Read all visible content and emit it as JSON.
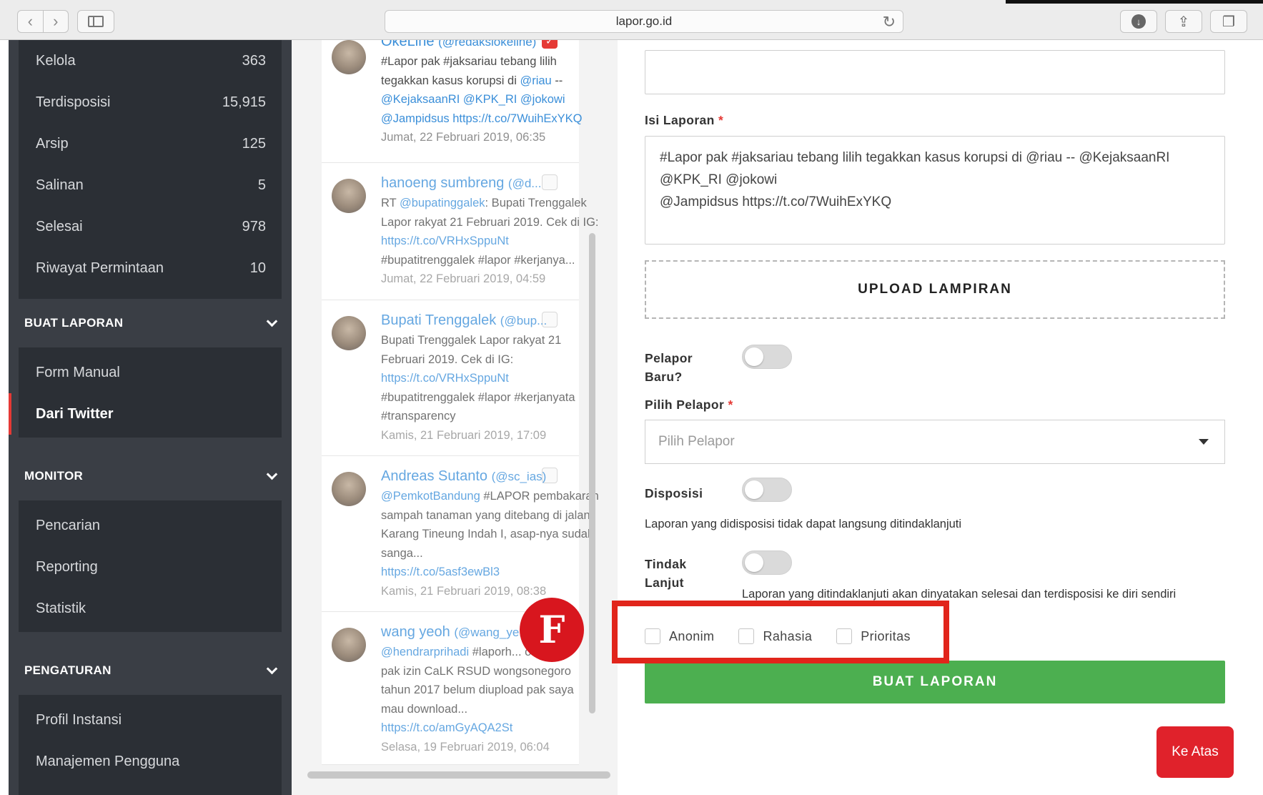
{
  "browser": {
    "url": "lapor.go.id",
    "back_icon": "chevron-left-icon",
    "forward_icon": "chevron-right-icon"
  },
  "sidebar": {
    "top_items": [
      {
        "label": "Kelola",
        "count": "363"
      },
      {
        "label": "Terdisposisi",
        "count": "15,915"
      },
      {
        "label": "Arsip",
        "count": "125"
      },
      {
        "label": "Salinan",
        "count": "5"
      },
      {
        "label": "Selesai",
        "count": "978"
      },
      {
        "label": "Riwayat Permintaan",
        "count": "10"
      }
    ],
    "sections": [
      {
        "title": "BUAT LAPORAN",
        "items": [
          "Form Manual",
          "Dari Twitter"
        ]
      },
      {
        "title": "MONITOR",
        "items": [
          "Pencarian",
          "Reporting",
          "Statistik"
        ]
      },
      {
        "title": "PENGATURAN",
        "items": [
          "Profil Instansi",
          "Manajemen Pengguna"
        ]
      }
    ],
    "active_item": "Dari Twitter",
    "accent_color": "#e53935"
  },
  "tweets": [
    {
      "name": "OkeLine",
      "handle": "(@redaksiokeline)",
      "text": "#Lapor pak #jaksariau tebang lilih tegakkan kasus korupsi di",
      "mention1": "@riau",
      "text2": "--",
      "line3": "@KejaksaanRI @KPK_RI @jokowi",
      "line4": "@Jampidsus https://t.co/7WuihExYKQ",
      "time": "Jumat, 22 Februari 2019, 06:35",
      "checked": true
    },
    {
      "name": "hanoeng sumbreng",
      "handle": "(@d...",
      "prefix": "RT",
      "mention": "@bupatinggalek",
      "text": ": Bupati Trenggalek Lapor rakyat 21 Februari 2019. Cek di IG:",
      "link": "https://t.co/VRHxSppuNt",
      "tags": "#bupatitrenggalek #lapor #kerjanya...",
      "time": "Jumat, 22 Februari 2019, 04:59"
    },
    {
      "name": "Bupati Trenggalek",
      "handle": "(@bup...",
      "text": "Bupati Trenggalek Lapor rakyat 21 Februari 2019. Cek di IG:",
      "link": "https://t.co/VRHxSppuNt",
      "tags": "#bupatitrenggalek #lapor #kerjanyata #transparency",
      "time": "Kamis, 21 Februari 2019, 17:09"
    },
    {
      "name": "Andreas Sutanto",
      "handle": "(@sc_ias)",
      "mention": "@PemkotBandung",
      "text": "#LAPOR pembakaran sampah tanaman yang ditebang di jalan Karang Tineung Indah I, asap-nya sudah sanga...",
      "link": "https://t.co/5asf3ewBl3",
      "time": "Kamis, 21 Februari 2019, 08:38"
    },
    {
      "name": "wang yeoh",
      "handle": "(@wang_ye...",
      "mention": "@hendrarprihadi",
      "text": "#laporh...",
      "text_tail": "or",
      "text2": "pak izin CaLK RSUD wongsonegoro tahun 2017 belum diupload pak saya mau download...",
      "link": "https://t.co/amGyAQA2St",
      "time": "Selasa, 19 Februari 2019, 06:04"
    }
  ],
  "form": {
    "isi_label": "Isi Laporan",
    "required_mark": "*",
    "isi_value_line1": "#Lapor pak #jaksariau tebang lilih tegakkan kasus korupsi di @riau -- @KejaksaanRI",
    "isi_value_line2": "@KPK_RI @jokowi",
    "isi_value_line3": "@Jampidsus https://t.co/7WuihExYKQ",
    "upload_label": "UPLOAD LAMPIRAN",
    "pelapor_baru_label_1": "Pelapor",
    "pelapor_baru_label_2": "Baru?",
    "pilih_pelapor_label": "Pilih Pelapor",
    "pilih_pelapor_placeholder": "Pilih Pelapor",
    "disposisi_label": "Disposisi",
    "disposisi_help": "Laporan yang didisposisi tidak dapat langsung ditindaklanjuti",
    "tindak_label_1": "Tindak",
    "tindak_label_2": "Lanjut",
    "tindak_help": "Laporan yang ditindaklanjuti akan dinyatakan selesai dan terdisposisi ke diri sendiri",
    "checkboxes": [
      "Anonim",
      "Rahasia",
      "Prioritas"
    ],
    "submit_label": "BUAT LAPORAN",
    "top_label": "Ke Atas",
    "submit_color": "#4caf50"
  },
  "annotation": {
    "badge_letter": "F",
    "highlight_color": "#e1251b"
  }
}
